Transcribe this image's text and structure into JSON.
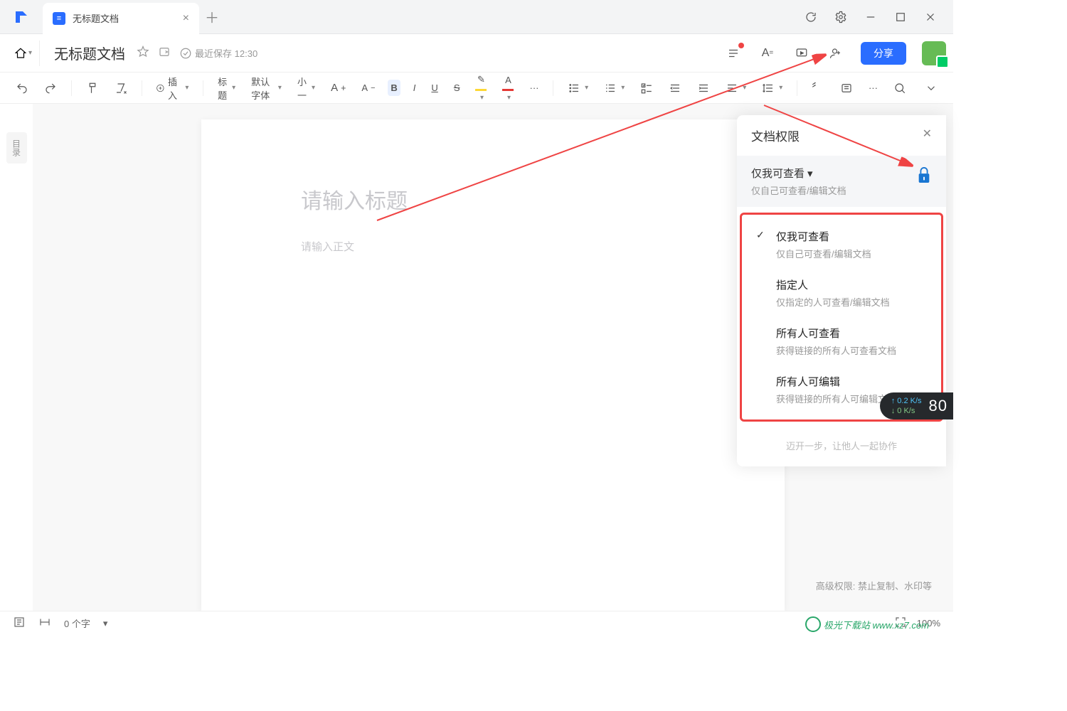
{
  "tab": {
    "title": "无标题文档"
  },
  "doc": {
    "title": "无标题文档",
    "saved": "最近保存 12:30"
  },
  "toolbar": {
    "insert": "插入",
    "heading": "标题",
    "font": "默认字体",
    "size": "小一",
    "bold": "B",
    "italic": "I",
    "underline": "U",
    "strike": "S",
    "fontA": "A",
    "fontA2": "A"
  },
  "share": {
    "label": "分享"
  },
  "page": {
    "title_ph": "请输入标题",
    "body_ph": "请输入正文"
  },
  "panel": {
    "title": "文档权限",
    "current": {
      "t": "仅我可查看",
      "d": "仅自己可查看/编辑文档"
    },
    "options": [
      {
        "checked": true,
        "t": "仅我可查看",
        "d": "仅自己可查看/编辑文档"
      },
      {
        "checked": false,
        "t": "指定人",
        "d": "仅指定的人可查看/编辑文档"
      },
      {
        "checked": false,
        "t": "所有人可查看",
        "d": "获得链接的所有人可查看文档"
      },
      {
        "checked": false,
        "t": "所有人可编辑",
        "d": "获得链接的所有人可编辑文档"
      }
    ],
    "footer": "迈开一步，让他人一起协作",
    "advanced": "高级权限: 禁止复制、水印等"
  },
  "status": {
    "words": "0 个字",
    "zoom": "100%"
  },
  "sidebar": {
    "toc": "目录"
  },
  "speed": {
    "up": "0.2 K/s",
    "down": "0 K/s",
    "percent": "80"
  },
  "watermark": "极光下载站 www.xz7.com"
}
